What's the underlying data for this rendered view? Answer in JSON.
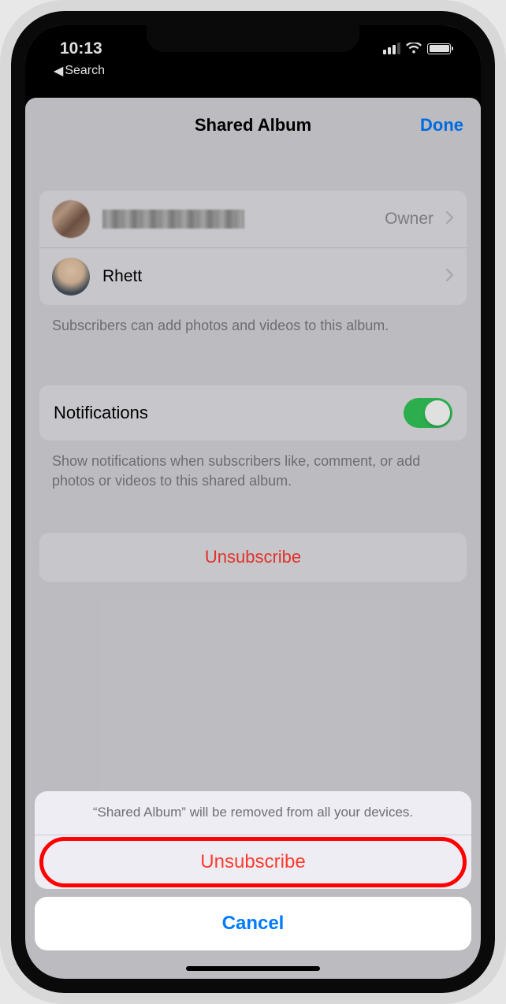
{
  "status": {
    "time": "10:13",
    "back_label": "Search"
  },
  "sheet": {
    "title": "Shared Album",
    "done": "Done"
  },
  "members": {
    "owner_label": "Owner",
    "subscriber_name": "Rhett",
    "footer": "Subscribers can add photos and videos to this album."
  },
  "notifications": {
    "label": "Notifications",
    "footer": "Show notifications when subscribers like, comment, or add photos or videos to this shared album."
  },
  "unsubscribe": {
    "button": "Unsubscribe"
  },
  "action_sheet": {
    "message": "“Shared Album” will be removed from all your devices.",
    "confirm": "Unsubscribe",
    "cancel": "Cancel"
  }
}
